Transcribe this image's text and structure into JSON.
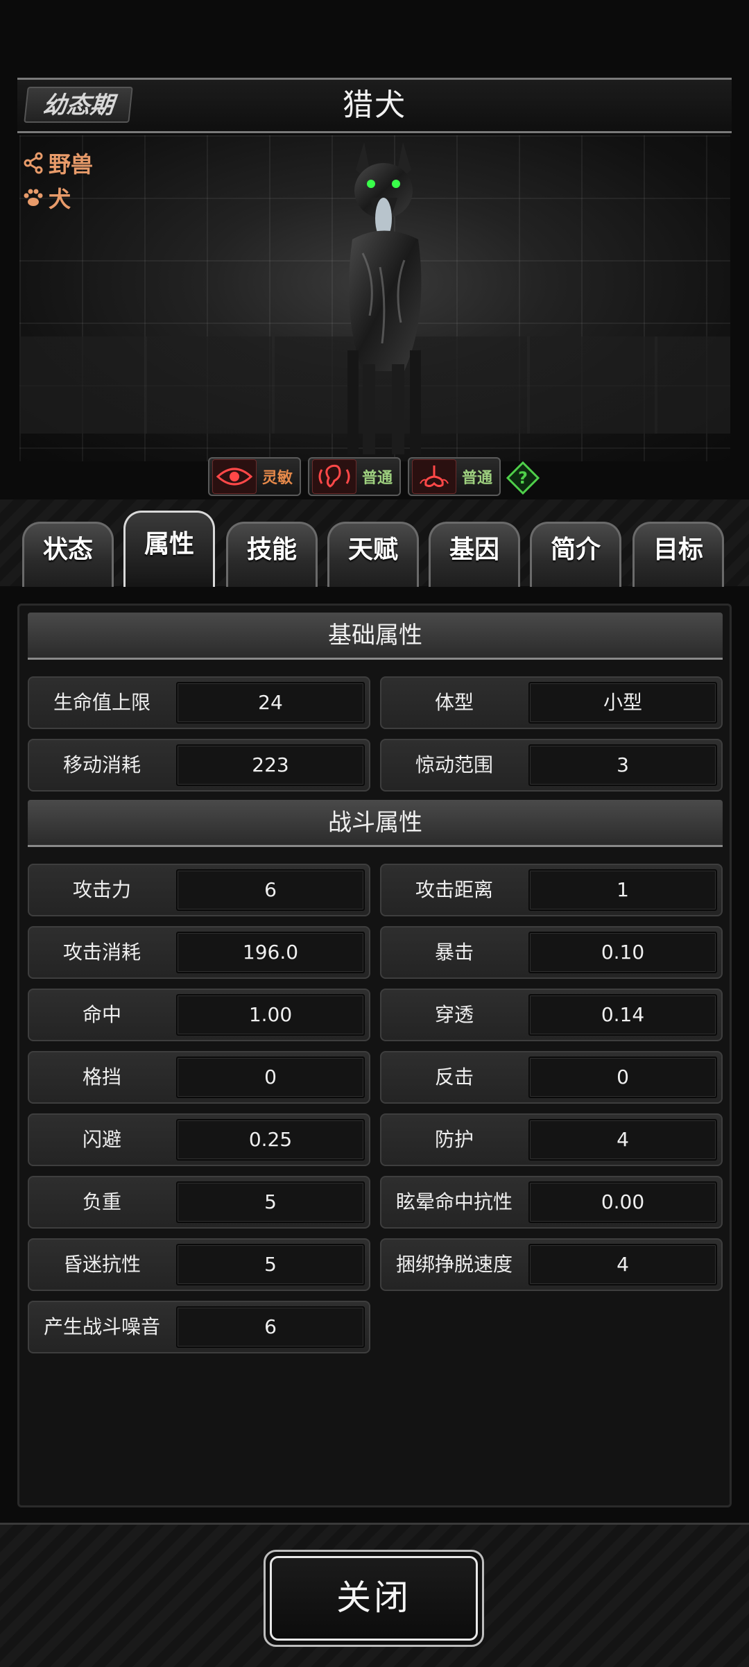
{
  "header": {
    "stage": "幼态期",
    "name": "猎犬"
  },
  "traits": [
    {
      "icon": "share-nodes-icon",
      "label": "野兽"
    },
    {
      "icon": "paw-icon",
      "label": "犬"
    }
  ],
  "senses": [
    {
      "icon": "eye-icon",
      "label": "灵敏",
      "color": "#e6894a"
    },
    {
      "icon": "ear-icon",
      "label": "普通",
      "color": "#9ed07f"
    },
    {
      "icon": "nose-icon",
      "label": "普通",
      "color": "#9ed07f"
    }
  ],
  "tabs": [
    "状态",
    "属性",
    "技能",
    "天赋",
    "基因",
    "简介",
    "目标"
  ],
  "active_tab": "属性",
  "sections": {
    "basic": {
      "title": "基础属性",
      "rows": [
        {
          "label": "生命值上限",
          "value": "24"
        },
        {
          "label": "体型",
          "value": "小型"
        },
        {
          "label": "移动消耗",
          "value": "223"
        },
        {
          "label": "惊动范围",
          "value": "3"
        }
      ]
    },
    "combat": {
      "title": "战斗属性",
      "rows": [
        {
          "label": "攻击力",
          "value": "6"
        },
        {
          "label": "攻击距离",
          "value": "1"
        },
        {
          "label": "攻击消耗",
          "value": "196.0"
        },
        {
          "label": "暴击",
          "value": "0.10"
        },
        {
          "label": "命中",
          "value": "1.00"
        },
        {
          "label": "穿透",
          "value": "0.14"
        },
        {
          "label": "格挡",
          "value": "0"
        },
        {
          "label": "反击",
          "value": "0"
        },
        {
          "label": "闪避",
          "value": "0.25"
        },
        {
          "label": "防护",
          "value": "4"
        },
        {
          "label": "负重",
          "value": "5"
        },
        {
          "label": "眩晕命中抗性",
          "value": "0.00"
        },
        {
          "label": "昏迷抗性",
          "value": "5"
        },
        {
          "label": "捆绑挣脱速度",
          "value": "4"
        },
        {
          "label": "产生战斗噪音",
          "value": "6"
        }
      ]
    }
  },
  "footer": {
    "close_label": "关闭"
  }
}
